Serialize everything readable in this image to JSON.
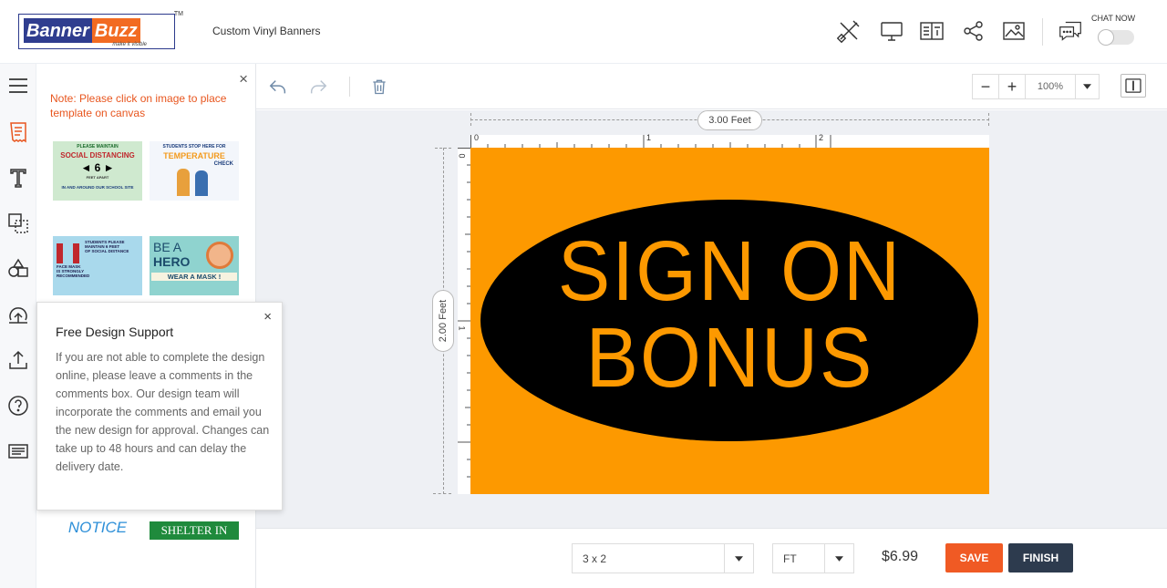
{
  "header": {
    "logo_part1": "Banner",
    "logo_part2": "Buzz",
    "logo_tagline": "make it visible",
    "logo_tm": "TM",
    "product_title": "Custom Vinyl Banners",
    "icons": [
      "design-tools-icon",
      "preview-icon",
      "book-icon",
      "share-icon",
      "image-icon",
      "chat-icon"
    ],
    "chat_label": "CHAT NOW",
    "chat_toggle_on": false
  },
  "rail": {
    "icons": [
      "menu-icon",
      "templates-icon",
      "text-icon",
      "clipart-icon",
      "shapes-icon",
      "upload-design-icon",
      "upload-icon",
      "help-icon",
      "comments-icon"
    ],
    "active": "templates-icon"
  },
  "panel": {
    "close": "×",
    "note": "Note: Please click on image to place template on canvas",
    "templates": [
      {
        "lines": [
          "PLEASE MAINTAIN",
          "SOCIAL DISTANCING",
          "◄ 6 ►",
          "FEET APART",
          "IN AND AROUND OUR SCHOOL SITE"
        ]
      },
      {
        "lines": [
          "STUDENTS STOP HERE FOR",
          "TEMPERATURE",
          "CHECK"
        ]
      },
      {
        "lines": [
          "STUDENTS PLEASE",
          "MAINTAIN 6 FEET",
          "OF SOCIAL DISTANCE",
          "FACE MASK",
          "IS STRONGLY",
          "RECOMMENDED"
        ]
      },
      {
        "lines": [
          "BE A",
          "HERO",
          "WEAR A MASK !"
        ]
      },
      {
        "lines": [
          "NOTICE"
        ]
      },
      {
        "lines": [
          "SHELTER IN"
        ]
      }
    ]
  },
  "support": {
    "close": "×",
    "title": "Free Design Support",
    "body": "If you are not able to complete the design online, please leave a comments in the comments box. Our design team will incorporate the comments and email you the new design for approval. Changes can take up to 48 hours and can delay the delivery date."
  },
  "toolbar": {
    "undo_icon": "undo-icon",
    "redo_icon": "redo-icon",
    "delete_icon": "trash-icon",
    "zoom_minus": "−",
    "zoom_plus": "+",
    "zoom_value": "100%",
    "layout_icon": "panel-toggle-icon"
  },
  "canvas": {
    "width_label": "3.00 Feet",
    "height_label": "2.00 Feet",
    "ruler_top": [
      "0",
      "1",
      "2"
    ],
    "ruler_left": [
      "0",
      "1"
    ],
    "line1": "SIGN ON",
    "line2": "BONUS",
    "background": "#fd9900",
    "oval_color": "#000000"
  },
  "bottom": {
    "size_value": "3 x 2",
    "unit_value": "FT",
    "price": "$6.99",
    "save_label": "SAVE",
    "finish_label": "FINISH"
  },
  "colors": {
    "accent": "#f05a24",
    "note": "#e8561f",
    "finish": "#2d3b4e"
  }
}
